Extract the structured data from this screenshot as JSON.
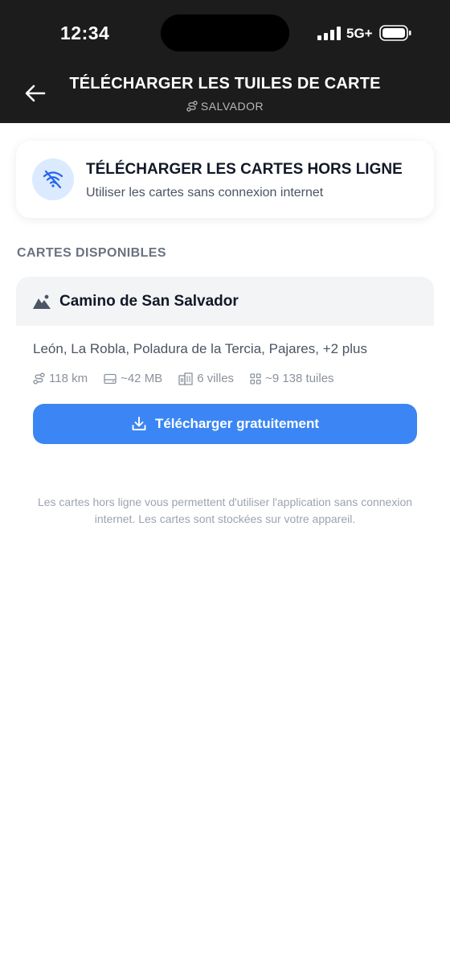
{
  "status_bar": {
    "time": "12:34",
    "network": "5G+"
  },
  "header": {
    "title": "TÉLÉCHARGER LES TUILES DE CARTE",
    "subtitle": "SALVADOR"
  },
  "offline_card": {
    "title": "TÉLÉCHARGER LES CARTES HORS LIGNE",
    "description": "Utiliser les cartes sans connexion internet"
  },
  "section_label": "CARTES DISPONIBLES",
  "route": {
    "name": "Camino de San Salvador",
    "towns": "León, La Robla, Poladura de la Tercia, Pajares, +2 plus",
    "stats": {
      "distance": "118 km",
      "size": "~42 MB",
      "towns_count": "6 villes",
      "tiles": "~9 138 tuiles"
    },
    "download_label": "Télécharger gratuitement"
  },
  "footnote": "Les cartes hors ligne vous permettent d'utiliser l'application sans connexion internet. Les cartes sont stockées sur votre appareil.",
  "colors": {
    "header_bg": "#1c1c1c",
    "accent": "#3b86f4",
    "icon_bg": "#dbeafe"
  },
  "icons": [
    "back-arrow-icon",
    "route-icon",
    "wifi-off-icon",
    "mountain-icon",
    "storage-icon",
    "buildings-icon",
    "grid-icon",
    "download-icon"
  ]
}
